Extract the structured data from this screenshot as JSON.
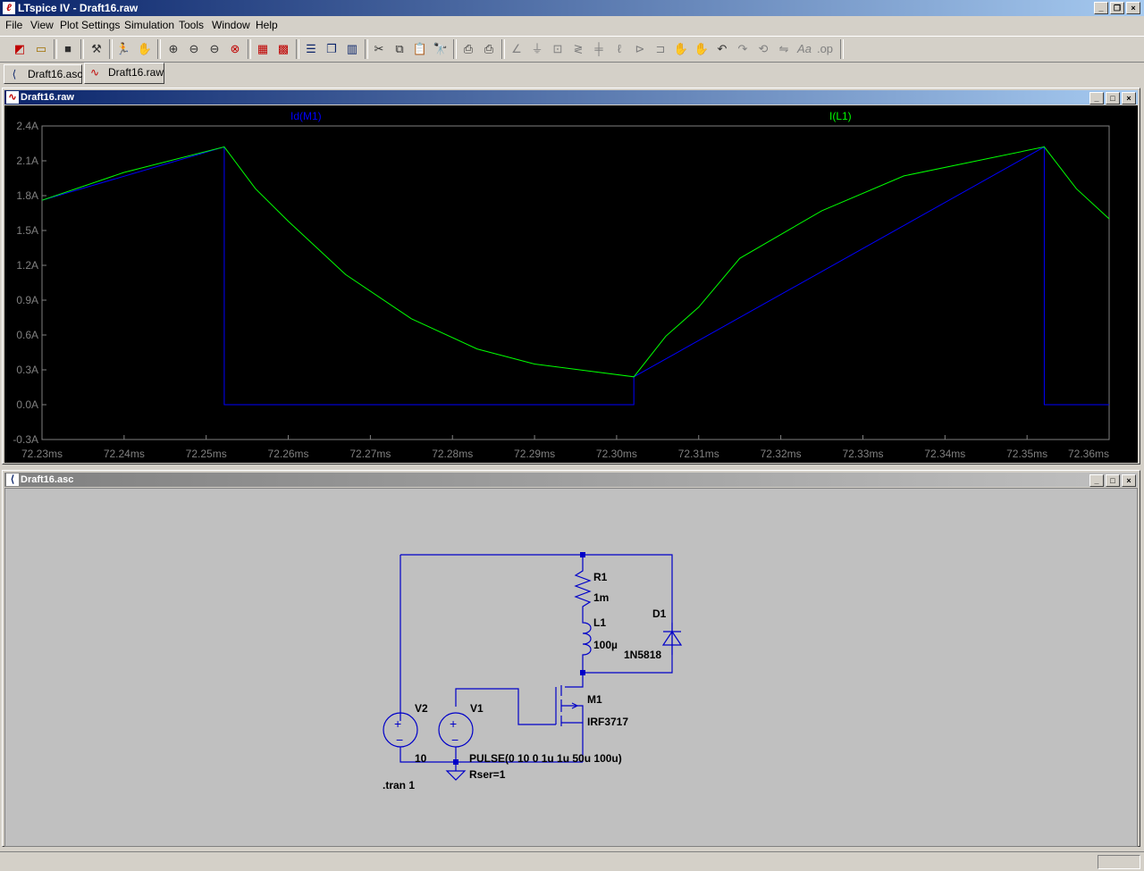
{
  "window": {
    "title": "LTspice IV - Draft16.raw",
    "app_icon": "ltspice-icon"
  },
  "menubar": {
    "items": [
      {
        "label": "File"
      },
      {
        "label": "View"
      },
      {
        "label": "Plot Settings"
      },
      {
        "label": "Simulation"
      },
      {
        "label": "Tools"
      },
      {
        "label": "Window"
      },
      {
        "label": "Help"
      }
    ]
  },
  "toolbar": {
    "icons": [
      "new-schematic-icon",
      "open-icon",
      "save-icon",
      "control-panel-icon",
      "run-icon",
      "halt-icon",
      "zoom-in-icon",
      "zoom-out-icon",
      "zoom-back-icon",
      "zoom-fit-icon",
      "autorange-icon",
      "grid-icon",
      "tile-horizontal-icon",
      "cascade-icon",
      "tile-vertical-icon",
      "cut-icon",
      "copy-icon",
      "paste-icon",
      "find-icon",
      "print-setup-icon",
      "print-icon",
      "wire-icon",
      "ground-icon",
      "label-net-icon",
      "resistor-icon",
      "capacitor-icon",
      "inductor-icon",
      "diode-icon",
      "component-icon",
      "move-icon",
      "drag-icon",
      "undo-icon",
      "redo-icon",
      "rotate-icon",
      "mirror-icon",
      "text-icon",
      "spice-directive-icon"
    ]
  },
  "tabs": [
    {
      "label": "Draft16.asc",
      "icon": "schematic-icon",
      "active": false
    },
    {
      "label": "Draft16.raw",
      "icon": "waveform-icon",
      "active": true
    }
  ],
  "plot_window": {
    "title": "Draft16.raw",
    "traces": [
      {
        "label": "Id(M1)",
        "color": "#0000ff"
      },
      {
        "label": "I(L1)",
        "color": "#00ff00"
      }
    ]
  },
  "chart_data": {
    "type": "line",
    "title": "",
    "xlabel": "",
    "ylabel": "",
    "xlim": [
      72.23,
      72.36
    ],
    "ylim": [
      -0.3,
      2.4
    ],
    "x_ticks": [
      "72.23ms",
      "72.24ms",
      "72.25ms",
      "72.26ms",
      "72.27ms",
      "72.28ms",
      "72.29ms",
      "72.30ms",
      "72.31ms",
      "72.32ms",
      "72.33ms",
      "72.34ms",
      "72.35ms",
      "72.36ms"
    ],
    "y_ticks": [
      "2.4A",
      "2.1A",
      "1.8A",
      "1.5A",
      "1.2A",
      "0.9A",
      "0.6A",
      "0.3A",
      "0.0A",
      "-0.3A"
    ],
    "y_tick_values": [
      2.4,
      2.1,
      1.8,
      1.5,
      1.2,
      0.9,
      0.6,
      0.3,
      0.0,
      -0.3
    ],
    "series": [
      {
        "name": "Id(M1)",
        "color": "#0000ff",
        "x": [
          72.23,
          72.2522,
          72.2522,
          72.3021,
          72.3021,
          72.3521,
          72.3521,
          72.36
        ],
        "y": [
          1.76,
          2.22,
          0.0,
          0.0,
          0.24,
          2.22,
          0.0,
          0.0
        ]
      },
      {
        "name": "I(L1)",
        "color": "#00ff00",
        "x": [
          72.23,
          72.24,
          72.2522,
          72.256,
          72.26,
          72.267,
          72.275,
          72.283,
          72.29,
          72.3021,
          72.306,
          72.31,
          72.315,
          72.325,
          72.335,
          72.3521,
          72.356,
          72.36
        ],
        "y": [
          1.76,
          2.0,
          2.22,
          1.86,
          1.58,
          1.12,
          0.74,
          0.48,
          0.35,
          0.24,
          0.59,
          0.84,
          1.26,
          1.67,
          1.97,
          2.22,
          1.86,
          1.6
        ]
      }
    ]
  },
  "schematic_window": {
    "title": "Draft16.asc",
    "labels": {
      "r1_name": "R1",
      "r1_value": "1m",
      "l1_name": "L1",
      "l1_value": "100µ",
      "d1_name": "D1",
      "d1_value": "1N5818",
      "m1_name": "M1",
      "m1_value": "IRF3717",
      "v2_name": "V2",
      "v2_value": "10",
      "v1_name": "V1",
      "v1_value": "PULSE(0 10 0 1u 1u 50u 100u)",
      "v1_rser": "Rser=1",
      "directive": ".tran 1"
    }
  }
}
